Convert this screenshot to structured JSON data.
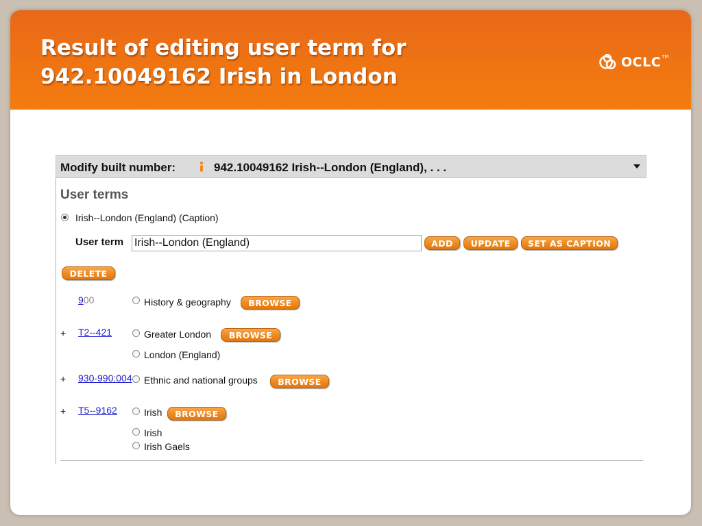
{
  "slide": {
    "title": "Result of editing user term for\n942.10049162 Irish in London",
    "logo_text": "OCLC",
    "logo_tm": "TM"
  },
  "panel": {
    "header_label": "Modify built number:",
    "header_value": "942.10049162 Irish--London (England), . . .",
    "section_title": "User terms",
    "caption_option": "Irish--London (England)  (Caption)",
    "user_term_label": "User term",
    "user_term_value": "Irish--London (England)",
    "buttons": {
      "add": "ADD",
      "update": "UPDATE",
      "set_as_caption": "SET AS CAPTION",
      "delete": "DELETE",
      "browse": "BROWSE"
    },
    "rows": [
      {
        "link_underlined": "9",
        "link_plain": "00",
        "options": [
          "History & geography"
        ]
      },
      {
        "plus": "+",
        "link": "T2--421",
        "options": [
          "Greater London",
          "London (England)"
        ]
      },
      {
        "plus": "+",
        "link": "930-990:004",
        "options": [
          "Ethnic and national groups"
        ]
      },
      {
        "plus": "+",
        "link": "T5--9162",
        "options": [
          "Irish",
          "Irish",
          "Irish Gaels"
        ]
      }
    ]
  },
  "colors": {
    "banner": "#ef7412",
    "button": "#ee8a1f",
    "link": "#2222cc"
  }
}
